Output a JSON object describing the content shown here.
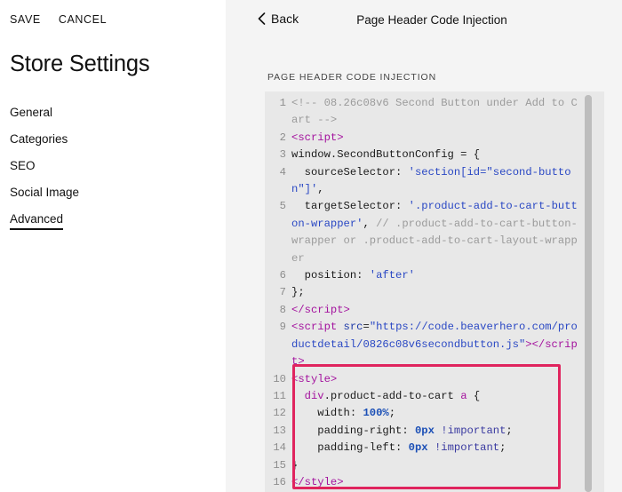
{
  "sidebar": {
    "save_label": "SAVE",
    "cancel_label": "CANCEL",
    "title": "Store Settings",
    "items": [
      {
        "label": "General"
      },
      {
        "label": "Categories"
      },
      {
        "label": "SEO"
      },
      {
        "label": "Social Image"
      },
      {
        "label": "Advanced"
      }
    ],
    "active_item": "Advanced"
  },
  "header": {
    "back_label": "Back",
    "title": "Page Header Code Injection"
  },
  "editor": {
    "section_label": "PAGE HEADER CODE INJECTION",
    "highlight_color": "#e0245e",
    "lines": [
      {
        "n": "1",
        "html": "<span class=\"tok-comment\">&lt;!-- 08.26c08v6 Second Button under Add to Cart --&gt;</span>"
      },
      {
        "n": "2",
        "html": "<span class=\"tok-tag\">&lt;script&gt;</span>"
      },
      {
        "n": "3",
        "html": "window.SecondButtonConfig = {"
      },
      {
        "n": "4",
        "html": "  sourceSelector: <span class=\"tok-str\">'section[id=\"second-button\"]'</span>,"
      },
      {
        "n": "5",
        "html": "  targetSelector: <span class=\"tok-str\">'.product-add-to-cart-button-wrapper'</span>, <span class=\"tok-comment\">// .product-add-to-cart-button-wrapper or .product-add-to-cart-layout-wrapper</span>"
      },
      {
        "n": "6",
        "html": "  position: <span class=\"tok-str\">'after'</span>"
      },
      {
        "n": "7",
        "html": "};"
      },
      {
        "n": "8",
        "html": "<span class=\"tok-tag\">&lt;/script&gt;</span>"
      },
      {
        "n": "9",
        "html": "<span class=\"tok-tag\">&lt;script</span> <span class=\"tok-attr\">src</span>=<span class=\"tok-str\">\"https://code.beaverhero.com/productdetail/0826c08v6secondbutton.js\"</span><span class=\"tok-tag\">&gt;&lt;/script&gt;</span>"
      },
      {
        "n": "10",
        "html": "<span class=\"tok-tag\">&lt;style&gt;</span>"
      },
      {
        "n": "11",
        "html": "  <span class=\"tok-tag\">div</span>.product-add-to-cart <span class=\"tok-tag\">a</span> {"
      },
      {
        "n": "12",
        "html": "    width: <span class=\"tok-num\">100%</span>;"
      },
      {
        "n": "13",
        "html": "    padding-right: <span class=\"tok-num\">0px</span> <span class=\"tok-imp\">!important</span>;"
      },
      {
        "n": "14",
        "html": "    padding-left: <span class=\"tok-num\">0px</span> <span class=\"tok-imp\">!important</span>;"
      },
      {
        "n": "15",
        "html": "}"
      },
      {
        "n": "16",
        "html": "<span class=\"tok-tag\">&lt;/style&gt;</span>"
      }
    ]
  }
}
